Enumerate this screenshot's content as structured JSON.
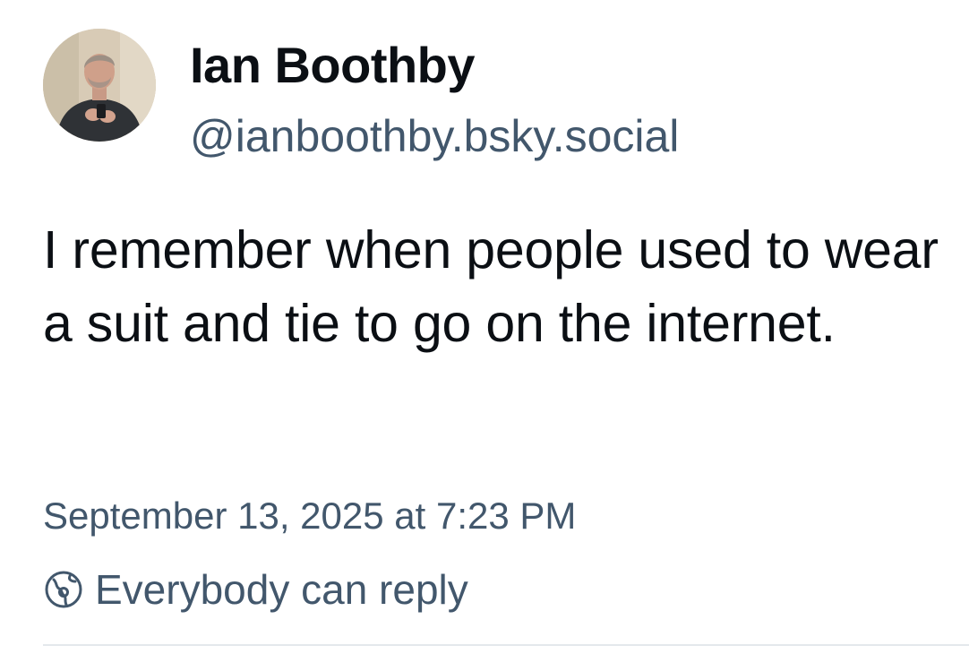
{
  "post": {
    "author": {
      "display_name": "Ian Boothby",
      "handle": "@ianboothby.bsky.social",
      "avatar_icon": "user-avatar-photo"
    },
    "text": "I remember when people used to wear a suit and tie to go on the internet.",
    "timestamp": "September 13, 2025 at 7:23 PM",
    "reply_setting": {
      "icon": "globe-earth-icon",
      "label": "Everybody can reply"
    }
  },
  "colors": {
    "primary_text": "#0b0f14",
    "secondary_text": "#42576c",
    "background": "#ffffff",
    "divider": "#e4e8ec"
  }
}
